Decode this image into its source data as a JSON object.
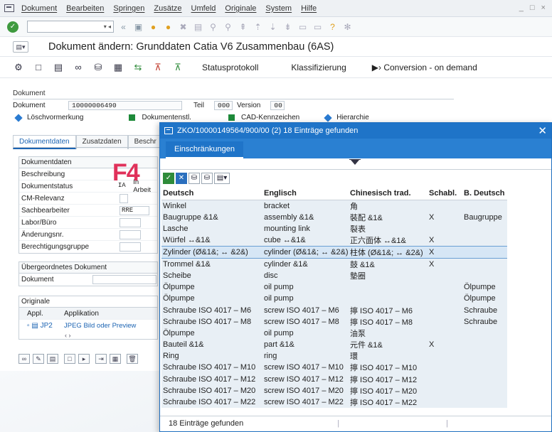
{
  "menubar": {
    "items": [
      "Dokument",
      "Bearbeiten",
      "Springen",
      "Zusätze",
      "Umfeld",
      "Originale",
      "System",
      "Hilfe"
    ],
    "window_controls": "_ □ ×"
  },
  "toolbar": {
    "command_field_value": ""
  },
  "page_title": "Dokument ändern: Grunddaten Catia V6 Zusammenbau (6AS)",
  "app_toolbar": {
    "statusprotokoll": "Statusprotokoll",
    "klassifizierung": "Klassifizierung",
    "conversion": "Conversion - on demand"
  },
  "document": {
    "header": "Dokument",
    "label_dokument": "Dokument",
    "dokument_value": "10000006490",
    "label_teil": "Teil",
    "teil_value": "000",
    "label_version": "Version",
    "version_value": "00",
    "legend_loesch": "Löschvormerkung",
    "legend_dokumentenstl": "Dokumentenstl.",
    "legend_cad": "CAD-Kennzeichen",
    "legend_hierarchie": "Hierarchie"
  },
  "tabs": [
    "Dokumentdaten",
    "Zusatzdaten",
    "Beschr"
  ],
  "dokumentdaten": {
    "header": "Dokumentdaten",
    "beschreibung": "Beschreibung",
    "dokumentstatus": "Dokumentstatus",
    "dokumentstatus_value": "IA",
    "dokumentstatus_text": "In Arbeit",
    "cm_relevanz": "CM-Relevanz",
    "sachbearbeiter": "Sachbearbeiter",
    "sachbearbeiter_value": "RRE",
    "labor": "Labor/Büro",
    "aenderungsnr": "Änderungsnr.",
    "berechtigungsgruppe": "Berechtigungsgruppe"
  },
  "f4_label": "F4",
  "uebergeordnet": {
    "header": "Übergeordnetes Dokument",
    "dokument": "Dokument"
  },
  "originale": {
    "header": "Originale",
    "col_appl": "Appl.",
    "col_applikation": "Applikation",
    "row_appl": "JP2",
    "row_applikation": "JPEG Bild oder Preview"
  },
  "popup": {
    "title": "ZKO/10000149564/900/00 (2)   18 Einträge gefunden",
    "tab": "Einschränkungen",
    "columns": [
      "Deutsch",
      "Englisch",
      "Chinesisch trad.",
      "Schabl.",
      "B. Deutsch"
    ],
    "rows": [
      [
        "Winkel",
        "bracket",
        "角",
        "",
        ""
      ],
      [
        "Baugruppe &1&",
        "assembly &1&",
        "裝配 &1&",
        "X",
        "Baugruppe"
      ],
      [
        "Lasche",
        "mounting link",
        "裂表",
        "",
        ""
      ],
      [
        "Würfel ↔&1&",
        "cube ↔&1&",
        "正六面体 ↔&1&",
        "X",
        ""
      ],
      [
        "Zylinder (Ø&1&; ↔ &2&)",
        "cylinder (Ø&1&; ↔ &2&)",
        "柱体 (Ø&1&; ↔ &2&)",
        "X",
        ""
      ],
      [
        "Trommel &1&",
        "cylinder &1&",
        "鼓 &1&",
        "X",
        ""
      ],
      [
        "Scheibe",
        "disc",
        "墊圈",
        "",
        ""
      ],
      [
        "Ölpumpe",
        "oil pump",
        "",
        "",
        "Ölpumpe"
      ],
      [
        "Ölpumpe",
        "oil pump",
        "",
        "",
        "Ölpumpe"
      ],
      [
        "Schraube ISO 4017 – M6",
        "screw ISO 4017 – M6",
        "擰 ISO 4017 – M6",
        "",
        "Schraube"
      ],
      [
        "Schraube ISO 4017 – M8",
        "screw ISO 4017 – M8",
        "擰 ISO 4017 – M8",
        "",
        "Schraube"
      ],
      [
        "Ölpumpe",
        "oil pump",
        "油泵",
        "",
        ""
      ],
      [
        "Bauteil &1&",
        "part &1&",
        "元件 &1&",
        "X",
        ""
      ],
      [
        "Ring",
        "ring",
        "環",
        "",
        ""
      ],
      [
        "Schraube ISO 4017 – M10",
        "screw ISO 4017 – M10",
        "擰 ISO 4017 – M10",
        "",
        ""
      ],
      [
        "Schraube ISO 4017 – M12",
        "screw ISO 4017 – M12",
        "擰 ISO 4017 – M12",
        "",
        ""
      ],
      [
        "Schraube ISO 4017 – M20",
        "screw ISO 4017 – M20",
        "擰 ISO 4017 – M20",
        "",
        ""
      ],
      [
        "Schraube ISO 4017 – M22",
        "screw ISO 4017 – M22",
        "擰 ISO 4017 – M22",
        "",
        ""
      ]
    ],
    "selected_row": 4,
    "status": "18 Einträge gefunden"
  },
  "colors": {
    "popup_title": "#1f74c8",
    "f4": "#e0315a",
    "legend_blue": "#2a7bd1",
    "legend_green": "#1e8a3a"
  }
}
